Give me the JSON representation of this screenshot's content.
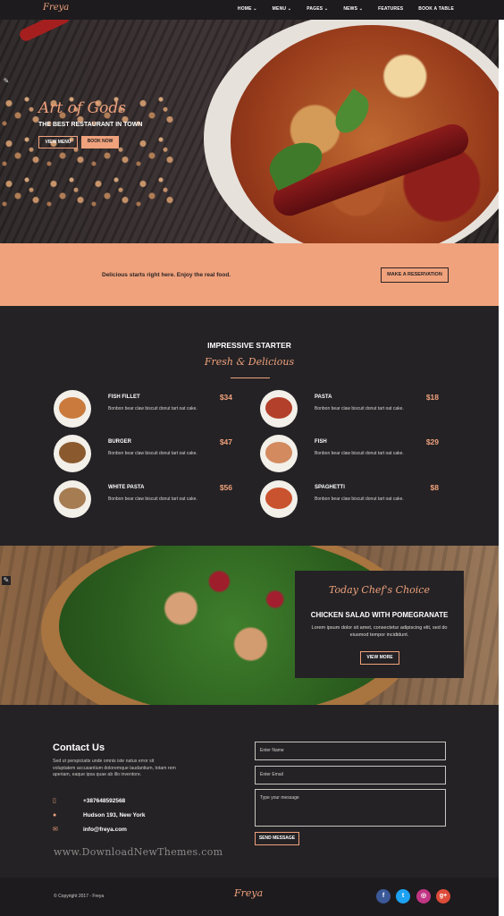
{
  "nav": {
    "logo": "Freya",
    "items": [
      "HOME ⌄",
      "MENU ⌄",
      "PAGES ⌄",
      "NEWS ⌄",
      "FEATURES",
      "BOOK A TABLE"
    ]
  },
  "hero": {
    "title": "Art of Gods",
    "subtitle": "THE BEST RESTAURANT IN TOWN",
    "view_menu": "VIEW MENU",
    "book_now": "BOOK NOW"
  },
  "banner": {
    "text": "Delicious starts right here. Enjoy the real food.",
    "button": "MAKE A RESERVATION"
  },
  "starter": {
    "title": "IMPRESSIVE STARTER",
    "script": "Fresh & Delicious",
    "dishes": [
      {
        "name": "FISH FILLET",
        "price": "$34",
        "desc": "Bonbon bear claw biscuit donut tart oat cake.",
        "color": "#c97a3c"
      },
      {
        "name": "PASTA",
        "price": "$18",
        "desc": "Bonbon bear claw biscuit donut tart oat cake.",
        "color": "#b3402a"
      },
      {
        "name": "BURGER",
        "price": "$47",
        "desc": "Bonbon bear claw biscuit donut tart oat cake.",
        "color": "#8a5a2e"
      },
      {
        "name": "FISH",
        "price": "$29",
        "desc": "Bonbon bear claw biscuit donut tart oat cake.",
        "color": "#d28a5e"
      },
      {
        "name": "WHITE PASTA",
        "price": "$56",
        "desc": "Bonbon bear claw biscuit donut tart oat cake.",
        "color": "#a67c52"
      },
      {
        "name": "SPAGHETTI",
        "price": "$8",
        "desc": "Bonbon bear claw biscuit donut tart oat cake.",
        "color": "#c9532f"
      }
    ]
  },
  "chef": {
    "script": "Today Chef's Choice",
    "title": "CHICKEN SALAD WITH POMEGRANATE",
    "desc": "Lorem ipsum dolor sit amet, consectetur adipiscing elit, sed do eiusmod tempor incididunt.",
    "button": "VIEW MORE"
  },
  "contact": {
    "title": "Contact Us",
    "desc": "Sed ut perspiciatis unde omnis iste natus error sit voluptatem accusantium doloremque laudantium, totam rem aperiam, eaque ipsa quae ab illo inventore.",
    "phone": "+387648592568",
    "address": "Hudson 193, New York",
    "email": "info@freya.com",
    "name_placeholder": "Enter Name",
    "email_placeholder": "Enter Email",
    "message_placeholder": "Type your message",
    "send": "SEND MESSAGE",
    "watermark": "www.DownloadNewThemes.com"
  },
  "footer": {
    "copyright": "© Copyright 2017 - Freya",
    "logo": "Freya",
    "social": [
      {
        "icon": "facebook-icon",
        "glyph": "f",
        "color": "#3b5998"
      },
      {
        "icon": "twitter-icon",
        "glyph": "t",
        "color": "#1da1f2"
      },
      {
        "icon": "instagram-icon",
        "glyph": "◎",
        "color": "#c13584"
      },
      {
        "icon": "google-plus-icon",
        "glyph": "g+",
        "color": "#dd4b39"
      }
    ]
  },
  "colors": {
    "accent": "#f0a27c",
    "dark": "#242225"
  }
}
